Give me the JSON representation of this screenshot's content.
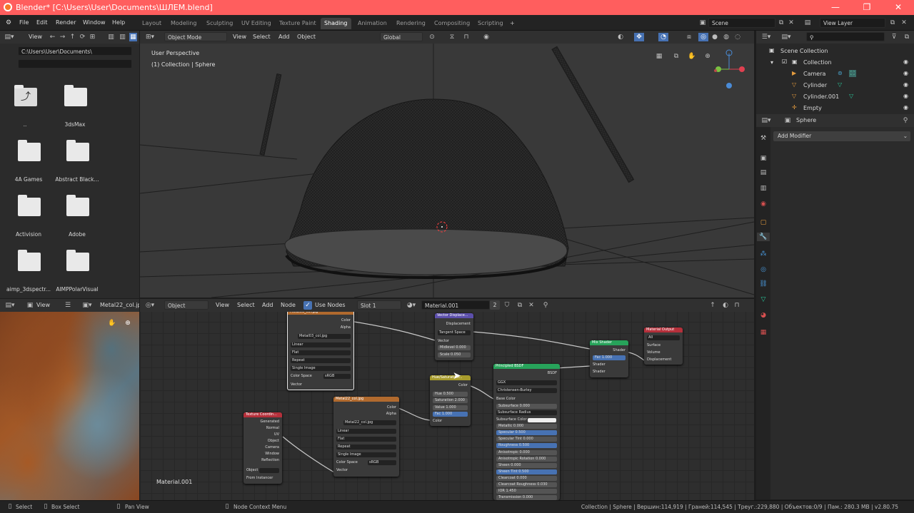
{
  "window": {
    "title": "Blender* [C:\\Users\\User\\Documents\\ШЛЕМ.blend]",
    "minimize": "—",
    "maximize": "❐",
    "close": "✕"
  },
  "menu": [
    "File",
    "Edit",
    "Render",
    "Window",
    "Help"
  ],
  "workspaces": [
    "Layout",
    "Modeling",
    "Sculpting",
    "UV Editing",
    "Texture Paint",
    "Shading",
    "Animation",
    "Rendering",
    "Compositing",
    "Scripting"
  ],
  "active_workspace": "Shading",
  "add_tab": "+",
  "scene": {
    "name": "Scene",
    "view_layer": "View Layer"
  },
  "file_browser": {
    "view_label": "View",
    "path": "C:\\Users\\User\\Documents\\",
    "filter": "",
    "items": [
      {
        "label": "..",
        "kind": "parent"
      },
      {
        "label": "3dsMax",
        "kind": "folder"
      },
      {
        "label": "4A Games",
        "kind": "folder"
      },
      {
        "label": "Abstract Black...",
        "kind": "folder"
      },
      {
        "label": "Activision",
        "kind": "folder"
      },
      {
        "label": "Adobe",
        "kind": "folder"
      },
      {
        "label": "aimp_3dspectr...",
        "kind": "folder"
      },
      {
        "label": "AIMPPolarVisual",
        "kind": "folder"
      }
    ]
  },
  "viewport": {
    "mode": "Object Mode",
    "menus": [
      "View",
      "Select",
      "Add",
      "Object"
    ],
    "orientation": "Global",
    "overlay_title": "User Perspective",
    "overlay_sub": "(1) Collection | Sphere"
  },
  "outliner": {
    "root": "Scene Collection",
    "collection": "Collection",
    "objects": [
      "Camera",
      "Cylinder",
      "Cylinder.001",
      "Empty"
    ]
  },
  "properties": {
    "object": "Sphere",
    "add_modifier": "Add Modifier"
  },
  "image_editor": {
    "view_label": "View",
    "image_name": "Metal22_col.jp"
  },
  "node_editor": {
    "object_type": "Object",
    "menus": [
      "View",
      "Select",
      "Add",
      "Node"
    ],
    "use_nodes_label": "Use Nodes",
    "slot": "Slot 1",
    "material": "Material.001",
    "users": "2",
    "canvas_label": "Material.001",
    "nodes": {
      "image1": {
        "title": "Metal03_col.jpg",
        "out1": "Color",
        "out2": "Alpha",
        "img": "Metal03_col.jpg",
        "interp": "Linear",
        "proj": "Flat",
        "ext": "Repeat",
        "src": "Single Image",
        "cs_label": "Color Space",
        "cs": "sRGB",
        "vec": "Vector"
      },
      "image2": {
        "title": "Metal22_col.jpg",
        "out1": "Color",
        "out2": "Alpha",
        "img": "Metal22_col.jpg",
        "interp": "Linear",
        "proj": "Flat",
        "ext": "Repeat",
        "src": "Single Image",
        "cs_label": "Color Space",
        "cs": "sRGB",
        "vec": "Vector"
      },
      "texcoord": {
        "title": "Texture Coordin...",
        "outs": [
          "Generated",
          "Normal",
          "UV",
          "Object",
          "Camera",
          "Window",
          "Reflection"
        ],
        "obj_label": "Object",
        "from": "From Instancer"
      },
      "displace": {
        "title": "Vector Displace...",
        "out": "Displacement",
        "space": "Tangent Space",
        "vec": "Vector",
        "mid": "Midlevel 0.000",
        "scale": "Scale 0.050"
      },
      "hsv": {
        "title": "Hue/Saturation...",
        "out": "Color",
        "hue": "Hue 0.500",
        "sat": "Saturation 2.000",
        "val": "Value 1.000",
        "fac": "Fac 1.000",
        "in": "Color"
      },
      "bsdf": {
        "title": "Principled BSDF",
        "out": "BSDF",
        "dist": "GGX",
        "sss": "Christensen-Burley",
        "fields": [
          "Base Color",
          "Subsurface 0.000",
          "Subsurface Radius",
          "Subsurface Color",
          "Metallic 0.000",
          "Specular 0.500",
          "Specular Tint 0.000",
          "Roughness 0.500",
          "Anisotropic 0.000",
          "Anisotropic Rotation 0.000",
          "Sheen 0.000",
          "Sheen Tint 0.500",
          "Clearcoat 0.000",
          "Clearcoat Roughness 0.030",
          "IOR 1.450",
          "Transmission 0.000"
        ]
      },
      "mix": {
        "title": "Mix Shader",
        "out": "Shader",
        "fac": "Fac 1.000",
        "in1": "Shader",
        "in2": "Shader"
      },
      "output": {
        "title": "Material Output",
        "target": "All",
        "surface": "Surface",
        "volume": "Volume",
        "displacement": "Displacement"
      }
    }
  },
  "status": {
    "select": "Select",
    "box_select": "Box Select",
    "pan": "Pan View",
    "context": "Node Context Menu",
    "stats": "Collection | Sphere | Вершин:114,919 | Граней:114,545 | Треуг.:229,880 | Объектов:0/9 | Пам.: 280.3 MB | v2.80.75"
  },
  "colors": {
    "title_bar": "#ff5e5e",
    "active_tab": "#424242",
    "image_node": "#b16a2e",
    "vector_node": "#5c4fab",
    "color_node": "#a79b2c",
    "shader_node": "#27a35a",
    "output_node": "#b5303b",
    "input_node": "#b5303b",
    "field_blue": "#4772b3"
  }
}
